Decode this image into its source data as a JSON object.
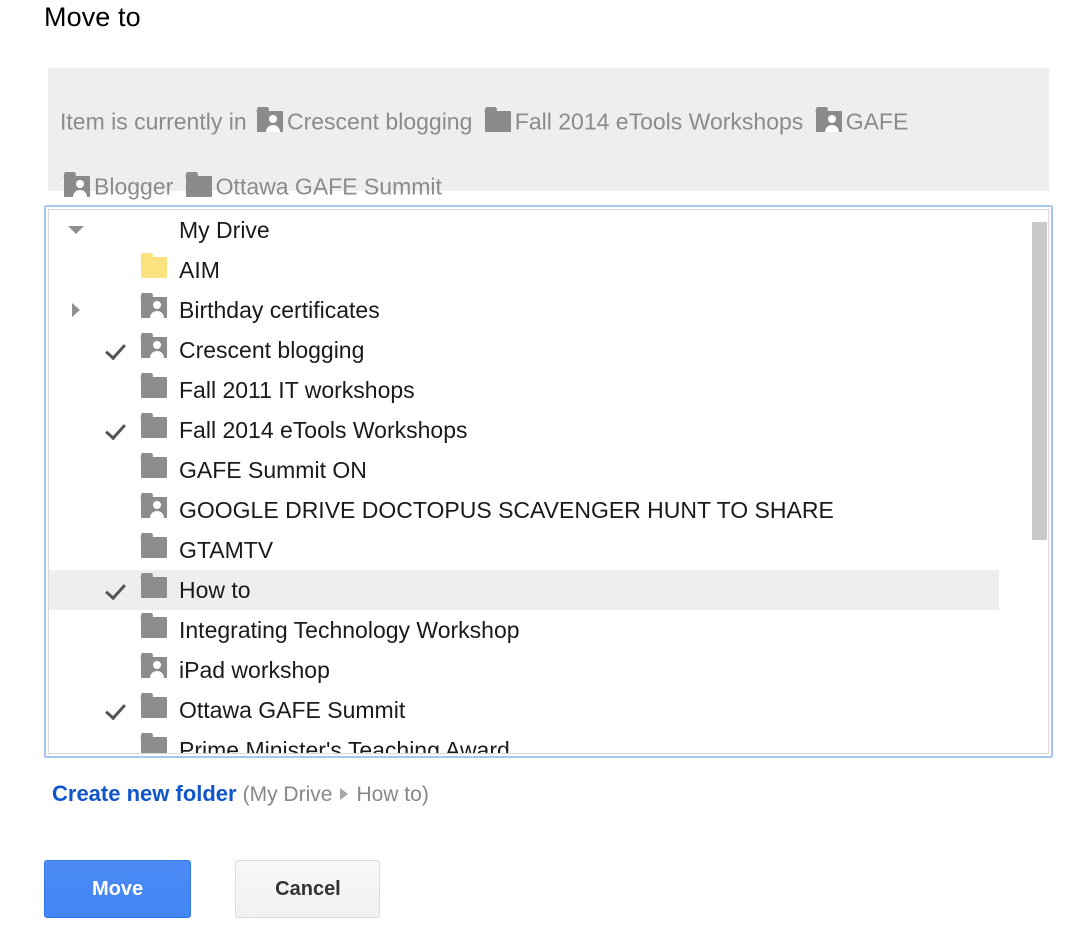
{
  "dialog": {
    "title": "Move to"
  },
  "location": {
    "prefix": "Item is currently in",
    "items": [
      {
        "label": "Crescent blogging",
        "icon": "shared-folder-icon"
      },
      {
        "label": "Fall 2014 eTools Workshops",
        "icon": "folder-icon"
      },
      {
        "label": "GAFE",
        "icon": "shared-folder-icon"
      },
      {
        "label": "Blogger",
        "icon": "shared-folder-icon"
      },
      {
        "label": "Ottawa GAFE Summit",
        "icon": "folder-icon"
      }
    ]
  },
  "tree": {
    "rows": [
      {
        "label": "My Drive",
        "icon": "none",
        "toggle": "expanded",
        "checked": false,
        "selected": false,
        "indent": 0
      },
      {
        "label": "AIM",
        "icon": "folder-icon-yellow",
        "toggle": "none",
        "checked": false,
        "selected": false,
        "indent": 1
      },
      {
        "label": "Birthday certificates",
        "icon": "shared-folder-icon",
        "toggle": "collapsed",
        "checked": false,
        "selected": false,
        "indent": 1
      },
      {
        "label": "Crescent blogging",
        "icon": "shared-folder-icon",
        "toggle": "none",
        "checked": true,
        "selected": false,
        "indent": 1
      },
      {
        "label": "Fall 2011 IT workshops",
        "icon": "folder-icon",
        "toggle": "none",
        "checked": false,
        "selected": false,
        "indent": 1
      },
      {
        "label": "Fall 2014 eTools Workshops",
        "icon": "folder-icon",
        "toggle": "none",
        "checked": true,
        "selected": false,
        "indent": 1
      },
      {
        "label": "GAFE Summit ON",
        "icon": "folder-icon",
        "toggle": "none",
        "checked": false,
        "selected": false,
        "indent": 1
      },
      {
        "label": "GOOGLE DRIVE DOCTOPUS SCAVENGER HUNT TO SHARE",
        "icon": "shared-folder-icon",
        "toggle": "none",
        "checked": false,
        "selected": false,
        "indent": 1
      },
      {
        "label": "GTAMTV",
        "icon": "folder-icon",
        "toggle": "none",
        "checked": false,
        "selected": false,
        "indent": 1
      },
      {
        "label": "How to",
        "icon": "folder-icon",
        "toggle": "none",
        "checked": true,
        "selected": true,
        "indent": 1
      },
      {
        "label": "Integrating Technology Workshop",
        "icon": "folder-icon",
        "toggle": "none",
        "checked": false,
        "selected": false,
        "indent": 1
      },
      {
        "label": "iPad workshop",
        "icon": "shared-folder-icon",
        "toggle": "none",
        "checked": false,
        "selected": false,
        "indent": 1
      },
      {
        "label": "Ottawa GAFE Summit",
        "icon": "folder-icon",
        "toggle": "none",
        "checked": true,
        "selected": false,
        "indent": 1
      },
      {
        "label": "Prime Minister's Teaching Award",
        "icon": "folder-icon",
        "toggle": "none",
        "checked": false,
        "selected": false,
        "indent": 1
      }
    ]
  },
  "create": {
    "link_label": "Create new folder",
    "breadcrumb_open": "(",
    "breadcrumb_root": "My Drive",
    "breadcrumb_leaf": "How to",
    "breadcrumb_close": ")"
  },
  "actions": {
    "move_label": "Move",
    "cancel_label": "Cancel"
  },
  "colors": {
    "primary_button": "#4285f4",
    "link": "#1155cc",
    "focus_border": "#a8c7f0",
    "selected_row": "#eeeeee",
    "location_bar": "#eeeeee",
    "folder_gray": "#8c8c8c",
    "folder_yellow": "#fae37f"
  }
}
